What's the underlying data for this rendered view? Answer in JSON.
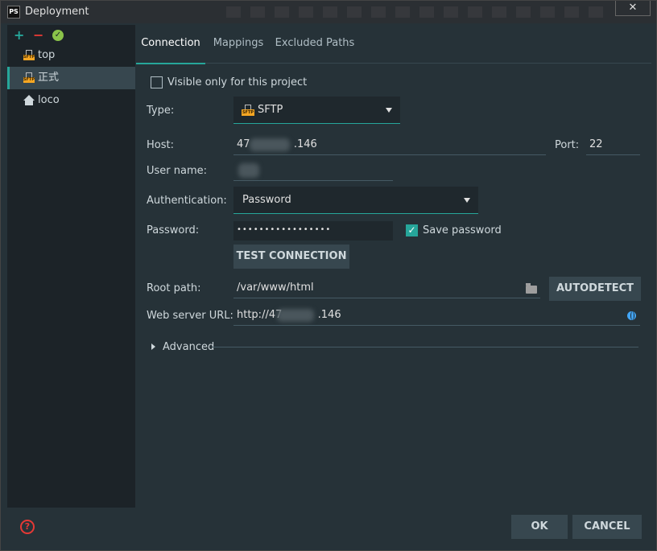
{
  "window": {
    "title": "Deployment",
    "app_icon": "PS",
    "close_label": "✕"
  },
  "sidebar": {
    "tools": {
      "add": "+",
      "remove": "−",
      "default": "✓"
    },
    "servers": [
      {
        "label": "top",
        "icon": "sftp-icon"
      },
      {
        "label": "正式",
        "icon": "sftp-icon",
        "selected": true
      },
      {
        "label": "loco",
        "icon": "home-icon"
      }
    ]
  },
  "tabs": [
    {
      "label": "Connection",
      "active": true
    },
    {
      "label": "Mappings"
    },
    {
      "label": "Excluded Paths"
    }
  ],
  "form": {
    "visible_only_label": "Visible only for this project",
    "type_label": "Type:",
    "type_value": "SFTP",
    "host_label": "Host:",
    "host_prefix": "47",
    "host_suffix": ".146",
    "port_label": "Port:",
    "port_value": "22",
    "username_label": "User name:",
    "auth_label": "Authentication:",
    "auth_value": "Password",
    "password_label": "Password:",
    "password_value": "•••••••••••••••••",
    "save_password_label": "Save password",
    "test_connection_label": "TEST CONNECTION",
    "root_path_label": "Root path:",
    "root_path_value": "/var/www/html",
    "autodetect_label": "AUTODETECT",
    "web_url_label": "Web server URL:",
    "web_url_prefix": "http://47",
    "web_url_suffix": ".146",
    "advanced_label": "Advanced"
  },
  "footer": {
    "ok_label": "OK",
    "cancel_label": "CANCEL",
    "help": "?"
  },
  "colors": {
    "accent": "#26a69a",
    "background": "#263238",
    "sidebar": "#1c2328",
    "button": "#37474f"
  }
}
